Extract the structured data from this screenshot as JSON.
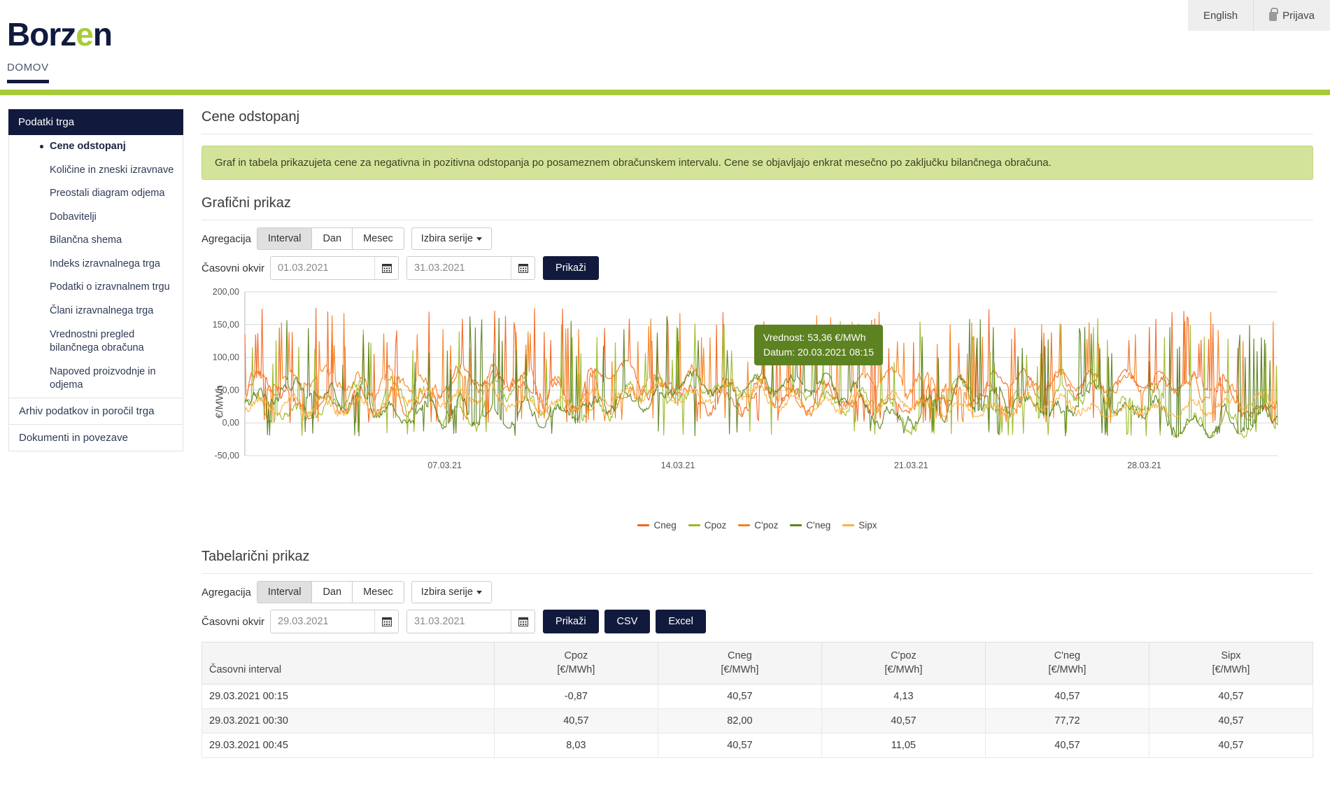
{
  "header": {
    "logo_text": "Borz",
    "logo_e": "e",
    "logo_tail": "n",
    "language_label": "English",
    "login_label": "Prijava"
  },
  "nav": {
    "home_label": "DOMOV"
  },
  "sidebar": {
    "group_title": "Podatki trga",
    "items": [
      {
        "label": "Cene odstopanj",
        "active": true
      },
      {
        "label": "Količine in zneski izravnave",
        "active": false
      },
      {
        "label": "Preostali diagram odjema",
        "active": false
      },
      {
        "label": "Dobavitelji",
        "active": false
      },
      {
        "label": "Bilančna shema",
        "active": false
      },
      {
        "label": "Indeks izravnalnega trga",
        "active": false
      },
      {
        "label": "Podatki o izravnalnem trgu",
        "active": false
      },
      {
        "label": "Člani izravnalnega trga",
        "active": false
      },
      {
        "label": "Vrednostni pregled bilančnega obračuna",
        "active": false
      },
      {
        "label": "Napoved proizvodnje in odjema",
        "active": false
      }
    ],
    "flat_items": [
      "Arhiv podatkov in poročil trga",
      "Dokumenti in povezave"
    ]
  },
  "main": {
    "page_title": "Cene odstopanj",
    "alert_text": "Graf in tabela prikazujeta cene za negativna in pozitivna odstopanja po posameznem obračunskem intervalu. Cene se objavljajo enkrat mesečno po zaključku bilančnega obračuna.",
    "chart_section_title": "Grafični prikaz",
    "table_section_title": "Tabelarični prikaz"
  },
  "chart_controls": {
    "aggregation_label": "Agregacija",
    "seg_interval": "Interval",
    "seg_day": "Dan",
    "seg_month": "Mesec",
    "series_picker": "Izbira serije",
    "timeframe_label": "Časovni okvir",
    "date_from": "01.03.2021",
    "date_to": "31.03.2021",
    "show_button": "Prikaži"
  },
  "table_controls": {
    "aggregation_label": "Agregacija",
    "seg_interval": "Interval",
    "seg_day": "Dan",
    "seg_month": "Mesec",
    "series_picker": "Izbira serije",
    "timeframe_label": "Časovni okvir",
    "date_from": "29.03.2021",
    "date_to": "31.03.2021",
    "show_button": "Prikaži",
    "csv_button": "CSV",
    "excel_button": "Excel"
  },
  "tooltip": {
    "value_line": "Vrednost: 53,36 €/MWh",
    "date_line": "Datum: 20.03.2021 08:15"
  },
  "chart_data": {
    "type": "line",
    "title": "",
    "xlabel": "",
    "ylabel": "€/MWh",
    "ylim": [
      -50,
      200
    ],
    "ytick_labels": [
      "200,00",
      "150,00",
      "100,00",
      "50,00",
      "0,00",
      "-50,00"
    ],
    "yticks": [
      200,
      150,
      100,
      50,
      0,
      -50
    ],
    "xtick_labels": [
      "07.03.21",
      "14.03.21",
      "21.03.21",
      "28.03.21"
    ],
    "x_range": [
      "01.03.2021",
      "31.03.2021"
    ],
    "grid": true,
    "legend_position": "bottom",
    "series": [
      {
        "name": "Cneg",
        "color": "#f26522",
        "typical_range": [
          0,
          175
        ]
      },
      {
        "name": "Cpoz",
        "color": "#9aba24",
        "typical_range": [
          -20,
          160
        ]
      },
      {
        "name": "C'poz",
        "color": "#f5821f",
        "typical_range": [
          0,
          170
        ]
      },
      {
        "name": "C'neg",
        "color": "#5d8221",
        "typical_range": [
          -20,
          165
        ]
      },
      {
        "name": "Sipx",
        "color": "#fcb040",
        "typical_range": [
          10,
          95
        ]
      }
    ],
    "highlight_point": {
      "value": 53.36,
      "datetime": "20.03.2021 08:15",
      "unit": "€/MWh"
    }
  },
  "table": {
    "columns": [
      {
        "name": "Časovni interval",
        "unit": ""
      },
      {
        "name": "Cpoz",
        "unit": "[€/MWh]"
      },
      {
        "name": "Cneg",
        "unit": "[€/MWh]"
      },
      {
        "name": "C'poz",
        "unit": "[€/MWh]"
      },
      {
        "name": "C'neg",
        "unit": "[€/MWh]"
      },
      {
        "name": "Sipx",
        "unit": "[€/MWh]"
      }
    ],
    "rows": [
      [
        "29.03.2021 00:15",
        "-0,87",
        "40,57",
        "4,13",
        "40,57",
        "40,57"
      ],
      [
        "29.03.2021 00:30",
        "40,57",
        "82,00",
        "40,57",
        "77,72",
        "40,57"
      ],
      [
        "29.03.2021 00:45",
        "8,03",
        "40,57",
        "11,05",
        "40,57",
        "40,57"
      ]
    ]
  }
}
